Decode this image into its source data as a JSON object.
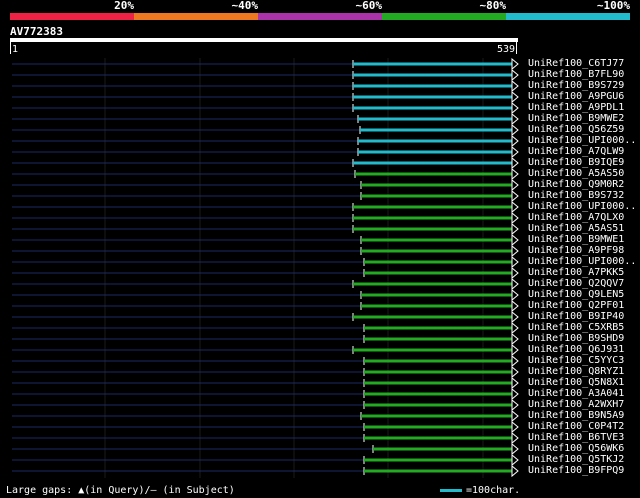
{
  "legend": [
    {
      "label": "20%",
      "color": "#ee2244"
    },
    {
      "label": "~40%",
      "color": "#ee7722"
    },
    {
      "label": "~60%",
      "color": "#aa33aa"
    },
    {
      "label": "~80%",
      "color": "#22aa22"
    },
    {
      "label": "~100%",
      "color": "#22bbcc"
    }
  ],
  "query": {
    "name": "AV772383",
    "start": "1",
    "end": "539"
  },
  "hits": [
    {
      "name": "UniRef100_C6TJ77",
      "color": "#22bbcc",
      "start": 353
    },
    {
      "name": "UniRef100_B7FL90",
      "color": "#22bbcc",
      "start": 353
    },
    {
      "name": "UniRef100_B9S729",
      "color": "#22bbcc",
      "start": 353
    },
    {
      "name": "UniRef100_A9PGU6",
      "color": "#22bbcc",
      "start": 353
    },
    {
      "name": "UniRef100_A9PDL1",
      "color": "#22bbcc",
      "start": 353
    },
    {
      "name": "UniRef100_B9MWE2",
      "color": "#22bbcc",
      "start": 358
    },
    {
      "name": "UniRef100_Q56Z59",
      "color": "#22bbcc",
      "start": 360
    },
    {
      "name": "UniRef100_UPI000..",
      "color": "#22bbcc",
      "start": 358
    },
    {
      "name": "UniRef100_A7QLW9",
      "color": "#22bbcc",
      "start": 358
    },
    {
      "name": "UniRef100_B9IQE9",
      "color": "#22bbcc",
      "start": 353
    },
    {
      "name": "UniRef100_A5AS50",
      "color": "#22aa22",
      "start": 355
    },
    {
      "name": "UniRef100_Q9M0R2",
      "color": "#22aa22",
      "start": 361
    },
    {
      "name": "UniRef100_B9S732",
      "color": "#22aa22",
      "start": 361
    },
    {
      "name": "UniRef100_UPI000..",
      "color": "#22aa22",
      "start": 353
    },
    {
      "name": "UniRef100_A7QLX0",
      "color": "#22aa22",
      "start": 353
    },
    {
      "name": "UniRef100_A5AS51",
      "color": "#22aa22",
      "start": 353
    },
    {
      "name": "UniRef100_B9MWE1",
      "color": "#22aa22",
      "start": 361
    },
    {
      "name": "UniRef100_A9PF98",
      "color": "#22aa22",
      "start": 361
    },
    {
      "name": "UniRef100_UPI000..",
      "color": "#22aa22",
      "start": 364
    },
    {
      "name": "UniRef100_A7PKK5",
      "color": "#22aa22",
      "start": 364
    },
    {
      "name": "UniRef100_Q2QQV7",
      "color": "#22aa22",
      "start": 353
    },
    {
      "name": "UniRef100_Q9LEN5",
      "color": "#22aa22",
      "start": 361
    },
    {
      "name": "UniRef100_Q2PF01",
      "color": "#22aa22",
      "start": 361
    },
    {
      "name": "UniRef100_B9IP40",
      "color": "#22aa22",
      "start": 353
    },
    {
      "name": "UniRef100_C5XRB5",
      "color": "#22aa22",
      "start": 364
    },
    {
      "name": "UniRef100_B9SHD9",
      "color": "#22aa22",
      "start": 364
    },
    {
      "name": "UniRef100_Q6J931",
      "color": "#22aa22",
      "start": 353
    },
    {
      "name": "UniRef100_C5YYC3",
      "color": "#22aa22",
      "start": 364
    },
    {
      "name": "UniRef100_Q8RYZ1",
      "color": "#22aa22",
      "start": 364
    },
    {
      "name": "UniRef100_Q5N8X1",
      "color": "#22aa22",
      "start": 364
    },
    {
      "name": "UniRef100_A3A041",
      "color": "#22aa22",
      "start": 364
    },
    {
      "name": "UniRef100_A2WXH7",
      "color": "#22aa22",
      "start": 364
    },
    {
      "name": "UniRef100_B9N5A9",
      "color": "#22aa22",
      "start": 361
    },
    {
      "name": "UniRef100_C0P4T2",
      "color": "#22aa22",
      "start": 364
    },
    {
      "name": "UniRef100_B6TVE3",
      "color": "#22aa22",
      "start": 364
    },
    {
      "name": "UniRef100_Q56WK6",
      "color": "#22aa22",
      "start": 373
    },
    {
      "name": "UniRef100_Q5TKJ2",
      "color": "#22aa22",
      "start": 364
    },
    {
      "name": "UniRef100_B9FPQ9",
      "color": "#22aa22",
      "start": 364
    }
  ],
  "footer": {
    "text": "Large gaps: ▲(in Query)/— (in Subject)",
    "scale_label": "=100char.",
    "scale_color": "#22bbcc"
  }
}
